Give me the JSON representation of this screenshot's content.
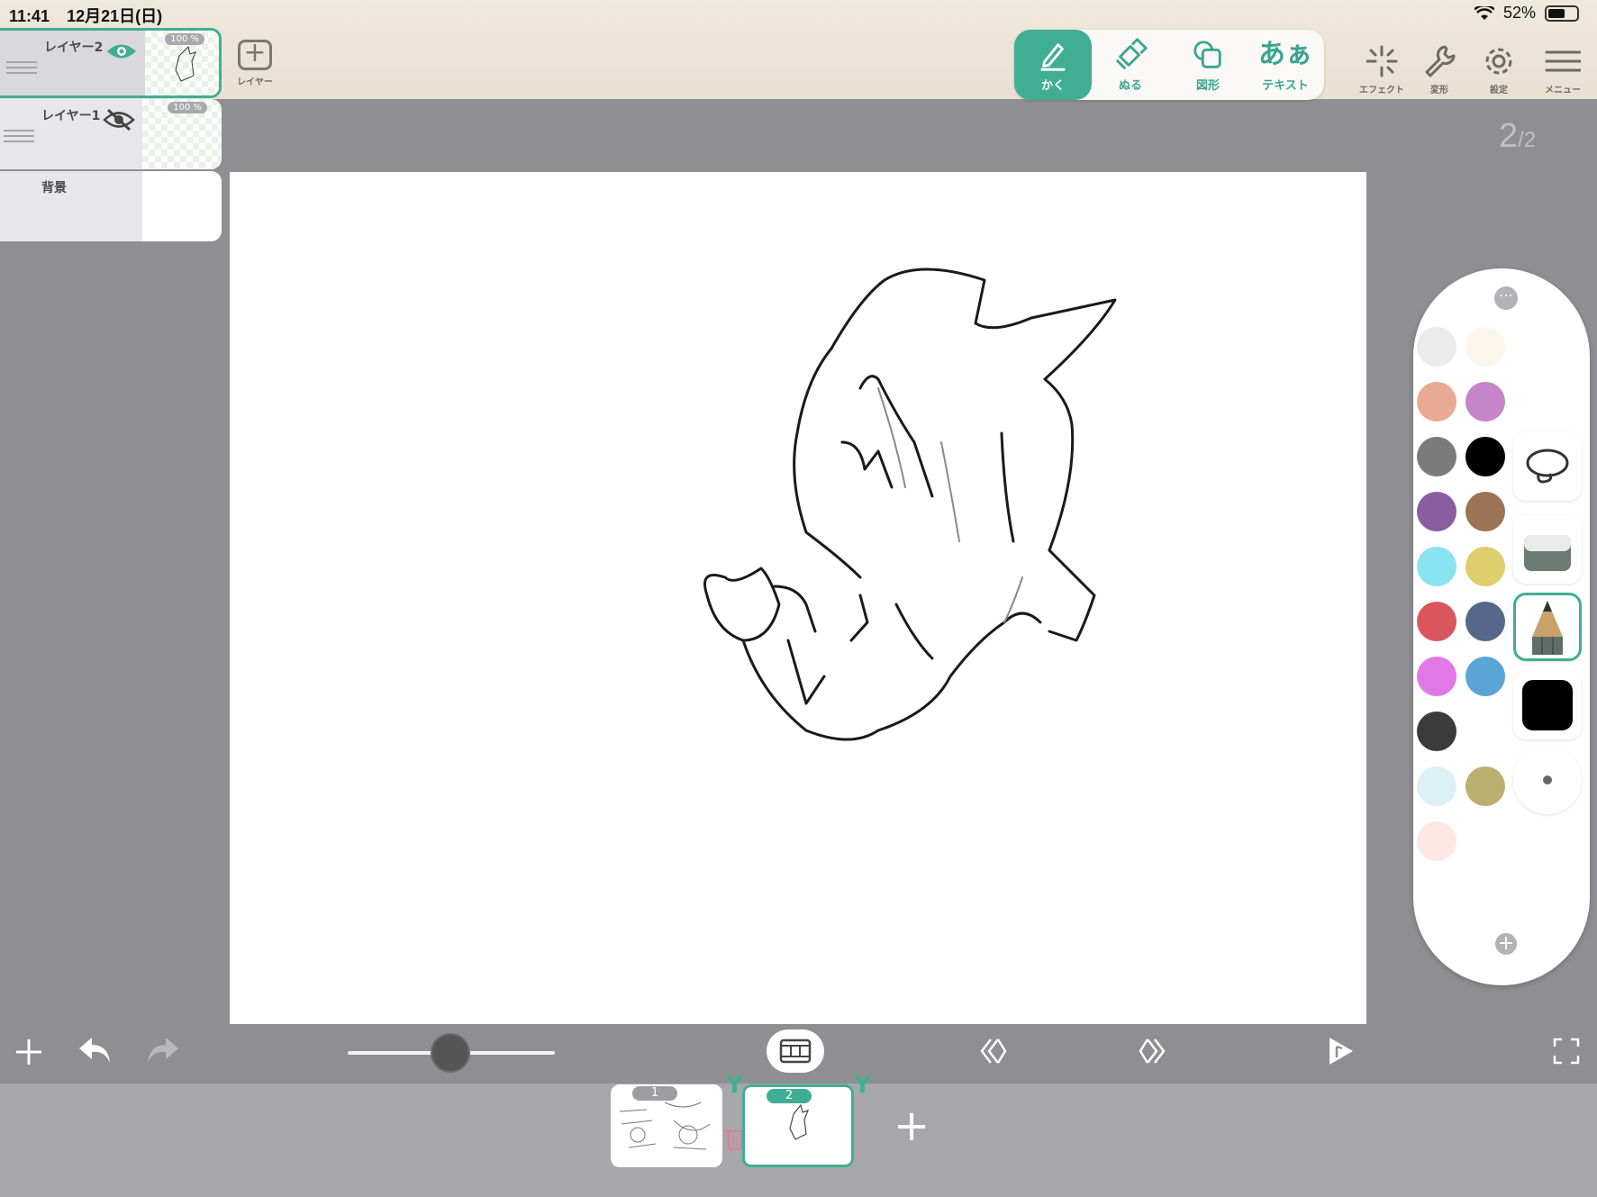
{
  "status": {
    "time": "11:41",
    "date": "12月21日(日)",
    "battery": "52%"
  },
  "toolbar": {
    "add_layer_label": "レイヤー",
    "tools": [
      {
        "label": "かく",
        "icon": "pen-icon",
        "active": true
      },
      {
        "label": "ぬる",
        "icon": "brush-icon",
        "active": false
      },
      {
        "label": "図形",
        "icon": "shapes-icon",
        "active": false
      },
      {
        "label": "テキスト",
        "icon": "text-icon",
        "glyph": "あぁ",
        "active": false
      }
    ],
    "effect_label": "エフェクト",
    "transform_label": "変形",
    "settings_label": "設定",
    "menu_label": "メニュー"
  },
  "layers": [
    {
      "name": "レイヤー2",
      "opacity": "100 %",
      "visible": true,
      "selected": true
    },
    {
      "name": "レイヤー1",
      "opacity": "100 %",
      "visible": false,
      "selected": false
    },
    {
      "name": "背景",
      "opacity": "",
      "visible": true,
      "selected": false
    }
  ],
  "page_counter": {
    "current": "2",
    "separator": "/",
    "total": "2"
  },
  "palette": {
    "colors": [
      "#ebebeb",
      "#fdf6ec",
      "#e8a995",
      "#c685c9",
      "#7b7b7b",
      "#000000",
      "#8a5ca0",
      "#9a7453",
      "#89e3f0",
      "#dfcf6c",
      "#d9575c",
      "#57678a",
      "#e078e8",
      "#5ba5d6",
      "#3b3b3b",
      "#ffffff",
      "#dcf1f6",
      "#bcae71",
      "#fde8e6"
    ],
    "more_label": "⋯",
    "add_label": "+"
  },
  "timeline": {
    "frames": [
      {
        "number": "1",
        "selected": false
      },
      {
        "number": "2",
        "selected": true
      }
    ],
    "add_frame_label": "+"
  },
  "colors": {
    "accent": "#3fae94",
    "canvas_bg": "#8e8e93"
  }
}
